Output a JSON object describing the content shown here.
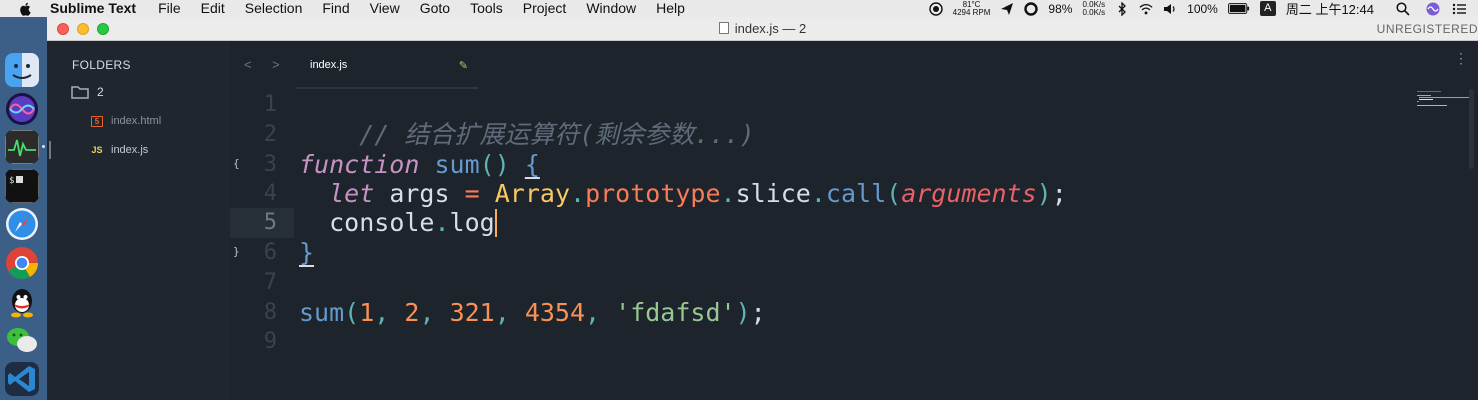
{
  "menubar": {
    "app_name": "Sublime Text",
    "items": [
      "File",
      "Edit",
      "Selection",
      "Find",
      "View",
      "Goto",
      "Tools",
      "Project",
      "Window",
      "Help"
    ],
    "status": {
      "temp": "81°C",
      "rpm": "4294 RPM",
      "battery_pct": "98%",
      "net_up": "0.0K/s",
      "net_down": "0.0K/s",
      "power": "100%",
      "input_method": "A",
      "clock": "周二 上午12:44"
    }
  },
  "window": {
    "title": "index.js — 2",
    "unregistered": "UNREGISTERED"
  },
  "sidebar": {
    "title": "FOLDERS",
    "folder": "2",
    "files": [
      {
        "badge": "5",
        "name": "index.html"
      },
      {
        "badge": "JS",
        "name": "index.js"
      }
    ]
  },
  "tabs": {
    "back": "<",
    "forward": ">",
    "active_tab": "index.js",
    "dirty_icon": "✎",
    "more": "⋮"
  },
  "editor": {
    "line_numbers": [
      "1",
      "2",
      "3",
      "4",
      "5",
      "6",
      "7",
      "8",
      "9"
    ],
    "current_line": 5,
    "fold_open": "{",
    "fold_close": "}",
    "line1_comment": "// 结合扩展运算符(剩余参数...)",
    "line3": {
      "kw": "function",
      "name": "sum",
      "parens": "()",
      "brace": "{"
    },
    "line4": {
      "kw": "let",
      "var": "args",
      "eq": "=",
      "cls": "Array",
      "dot1": ".",
      "proto": "prototype",
      "dot2": ".",
      "slice": "slice",
      "dot3": ".",
      "call": "call",
      "open": "(",
      "arguments": "arguments",
      "close": ")",
      "semi": ";"
    },
    "line5": {
      "obj": "console",
      "dot": ".",
      "method": "log"
    },
    "line6": {
      "brace": "}"
    },
    "line8": {
      "fn": "sum",
      "open": "(",
      "n1": "1",
      "c1": ", ",
      "n2": "2",
      "c2": ", ",
      "n3": "321",
      "c3": ", ",
      "n4": "4354",
      "c4": ", ",
      "str": "'fdafsd'",
      "close": ")",
      "semi": ";"
    }
  },
  "colors": {
    "editor_bg": "#1d242b",
    "dock_bg": "#3b5f87",
    "accent_keyword": "#c594c5",
    "accent_function": "#6699cc",
    "accent_number": "#f99157",
    "accent_string": "#99c794"
  },
  "dock_icons": [
    "finder-icon",
    "siri-icon",
    "activity-monitor-icon",
    "terminal-icon",
    "safari-icon",
    "chrome-icon",
    "qq-icon",
    "wechat-icon",
    "vscode-icon"
  ]
}
